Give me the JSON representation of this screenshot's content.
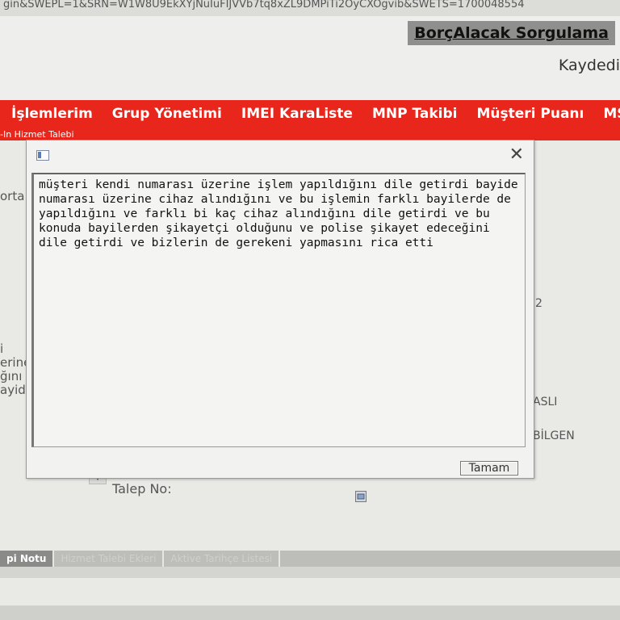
{
  "browser": {
    "url": "gin&SWEPL=1&SRN=W1W8U9EkXYjNuIuFIJVVb7tq8xZL9DMPiTi2OyCXOgvib&SWETS=1700048554"
  },
  "header": {
    "title": "BorçAlacak Sorgulama",
    "save_link": "Kaydedi"
  },
  "nav": {
    "items": [
      {
        "label": "İşlemlerim"
      },
      {
        "label": "Grup Yönetimi"
      },
      {
        "label": "IMEI KaraListe"
      },
      {
        "label": "MNP Takibi"
      },
      {
        "label": "Müşteri Puanı"
      },
      {
        "label": "MS"
      }
    ],
    "sub_label": "-In Hizmet Talebi"
  },
  "background": {
    "left_text_1": "orta",
    "left_text_2": "i\nerine\nğını\nayide",
    "right_number": "2",
    "right_name_1": "ASLI",
    "right_name_2": "BİLGEN",
    "talep_label": "Talep No:",
    "dropdown_arrow": "▼"
  },
  "bottom_tabs": [
    {
      "label": "pi Notu",
      "active": true
    },
    {
      "label": "Hizmet Talebi Ekleri",
      "active": false
    },
    {
      "label": "Aktive Tarihçe Listesi",
      "active": false
    }
  ],
  "dialog": {
    "close_symbol": "✕",
    "message": "müşteri kendi numarası üzerine işlem yapıldığını dile getirdi bayide numarası üzerine cihaz alındığını ve bu işlemin farklı bayilerde de yapıldığını ve farklı bi kaç cihaz alındığını dile getirdi ve bu  konuda bayilerden şikayetçi olduğunu ve polise şikayet edeceğini dile getirdi ve bizlerin de gerekeni yapmasını rica etti",
    "ok_label": "Tamam"
  },
  "colors": {
    "nav_red": "#e8261b",
    "page_bg": "#e9e9e6",
    "title_bg": "#8f8f8d"
  }
}
